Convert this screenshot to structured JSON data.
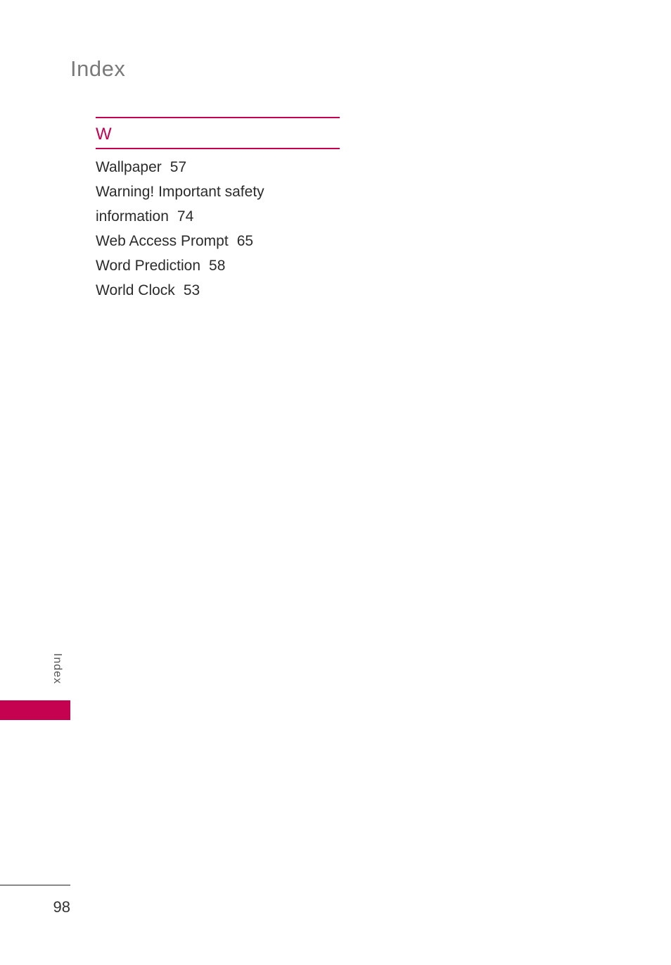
{
  "page": {
    "title": "Index",
    "side_label": "Index",
    "page_number": "98",
    "accent_color": "#c4024f"
  },
  "section": {
    "letter": "W",
    "entries": [
      {
        "term": "Wallpaper",
        "page": "57"
      },
      {
        "term": "Warning! Important safety",
        "page": ""
      },
      {
        "term": "information",
        "page": "74"
      },
      {
        "term": "Web Access Prompt",
        "page": "65"
      },
      {
        "term": "Word Prediction",
        "page": "58"
      },
      {
        "term": "World Clock",
        "page": "53"
      }
    ]
  }
}
